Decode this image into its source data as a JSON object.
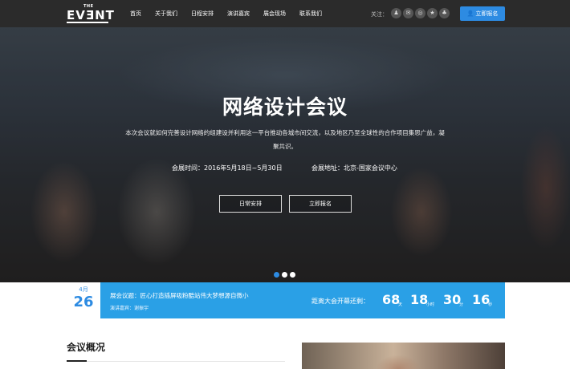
{
  "header": {
    "logo_top": "THE",
    "logo_main": "EVƎNT",
    "nav": [
      "首页",
      "关于我们",
      "日程安排",
      "演讲嘉宾",
      "展会现场",
      "联系我们"
    ],
    "follow_label": "关注：",
    "social_icons": [
      "qq-icon",
      "wechat-icon",
      "weibo-icon",
      "star-icon",
      "renren-icon"
    ],
    "register_label": "立即报名"
  },
  "hero": {
    "title": "网络设计会议",
    "description": "本次会议就如何完善设计网络的组建设并利用这一平台推动各城市间交流，以及地区乃至全球性的合作项目集思广益，凝聚共识。",
    "time": "会展时间：2016年5月18日~5月30日",
    "place": "会展地址：北京-国家会议中心",
    "btn_schedule": "日常安排",
    "btn_register": "立即报名",
    "slides": 3,
    "active_slide": 1
  },
  "infobar": {
    "month": "4月",
    "day": "26",
    "topic": "展会议题：匠心打造插屏吸粉酷站伟大梦想源自微小",
    "speaker": "演讲嘉宾：谢振宇",
    "countdown_label": "距离大会开幕还剩：",
    "days": "68",
    "days_unit": "天",
    "hours": "18",
    "hours_unit": "小时",
    "minutes": "30",
    "minutes_unit": "分",
    "seconds": "16",
    "seconds_unit": "秒"
  },
  "overview": {
    "title": "会议概况"
  },
  "colors": {
    "accent": "#2d8be2",
    "infobar": "#2aa0e6",
    "header": "#2b2b2b"
  }
}
